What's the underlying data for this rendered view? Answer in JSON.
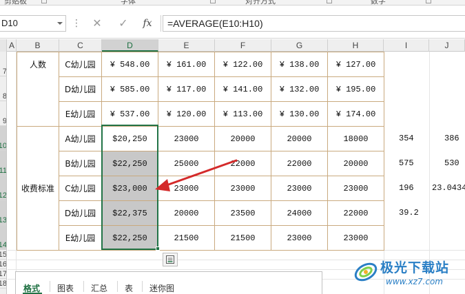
{
  "ribbon": {
    "groups": [
      "剪贴板",
      "字体",
      "对齐方式",
      "数字"
    ]
  },
  "formula_bar": {
    "name_box": "D10",
    "cancel_icon": "cancel-icon",
    "enter_icon": "check-icon",
    "fx_label": "fx",
    "formula": "=AVERAGE(E10:H10)"
  },
  "columns": [
    "A",
    "B",
    "C",
    "D",
    "E",
    "F",
    "G",
    "H",
    "I",
    "J"
  ],
  "rows": [
    "7",
    "8",
    "9",
    "10",
    "11",
    "12",
    "13",
    "14",
    "15",
    "16",
    "17",
    "18"
  ],
  "sheet": {
    "group1_label": "人数",
    "group2_label": "收费标准",
    "people_rows": [
      {
        "name": "C幼儿园",
        "d": "¥ 548.00",
        "e": "¥ 161.00",
        "f": "¥ 122.00",
        "g": "¥ 138.00",
        "h": "¥ 127.00"
      },
      {
        "name": "D幼儿园",
        "d": "¥ 585.00",
        "e": "¥ 117.00",
        "f": "¥ 141.00",
        "g": "¥ 132.00",
        "h": "¥ 195.00"
      },
      {
        "name": "E幼儿园",
        "d": "¥ 537.00",
        "e": "¥ 120.00",
        "f": "¥ 113.00",
        "g": "¥ 130.00",
        "h": "¥ 174.00"
      }
    ],
    "fee_rows": [
      {
        "name": "A幼儿园",
        "d": "$20,250",
        "e": "23000",
        "f": "20000",
        "g": "20000",
        "h": "18000",
        "i": "354",
        "j": "386"
      },
      {
        "name": "B幼儿园",
        "d": "$22,250",
        "e": "25000",
        "f": "22000",
        "g": "22000",
        "h": "20000",
        "i": "575",
        "j": "530"
      },
      {
        "name": "C幼儿园",
        "d": "$23,000",
        "e": "23000",
        "f": "23000",
        "g": "23000",
        "h": "23000",
        "i": "196",
        "j": "23.0434"
      },
      {
        "name": "D幼儿园",
        "d": "$22,375",
        "e": "20000",
        "f": "23500",
        "g": "24000",
        "h": "22000",
        "i": "39.2",
        "j": ""
      },
      {
        "name": "E幼儿园",
        "d": "$22,250",
        "e": "21500",
        "f": "21500",
        "g": "23000",
        "h": "23000",
        "i": "",
        "j": ""
      }
    ]
  },
  "quick_analysis": {
    "button_icon": "quick-analysis-icon",
    "tabs": [
      "格式",
      "图表",
      "汇总",
      "表",
      "迷你图"
    ]
  },
  "watermark": {
    "title": "极光下载站",
    "url": "www.xz7.com"
  },
  "colors": {
    "accent": "#217346",
    "arrow": "#d42a2a",
    "table_border": "#c9a97e",
    "selection_fill": "#c8c8c8",
    "watermark": "#2a7fc5"
  }
}
